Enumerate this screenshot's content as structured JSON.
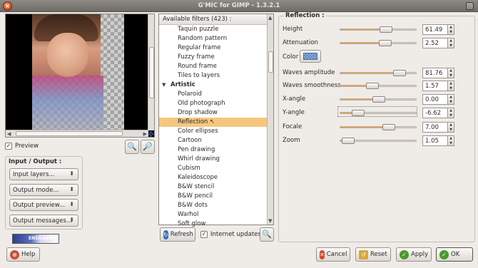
{
  "window": {
    "title": "G'MIC for GIMP - 1.3.2.1"
  },
  "preview": {
    "checkbox_label": "Preview",
    "checked": true
  },
  "io": {
    "title": "Input / Output :",
    "combos": [
      "Input layers...",
      "Output mode...",
      "Output preview...",
      "Output messages..."
    ]
  },
  "logo": {
    "text": "ENSICAEN"
  },
  "filters": {
    "header": "Available filters (423) :",
    "items": [
      {
        "label": "Taquin puzzle",
        "kind": "item"
      },
      {
        "label": "Random pattern",
        "kind": "item"
      },
      {
        "label": "Regular frame",
        "kind": "item"
      },
      {
        "label": "Fuzzy frame",
        "kind": "item"
      },
      {
        "label": "Round frame",
        "kind": "item"
      },
      {
        "label": "Tiles to layers",
        "kind": "item"
      },
      {
        "label": "Artistic",
        "kind": "category"
      },
      {
        "label": "Polaroid",
        "kind": "item"
      },
      {
        "label": "Old photograph",
        "kind": "item"
      },
      {
        "label": "Drop shadow",
        "kind": "item"
      },
      {
        "label": "Reflection",
        "kind": "selected"
      },
      {
        "label": "Color ellipses",
        "kind": "item"
      },
      {
        "label": "Cartoon",
        "kind": "item"
      },
      {
        "label": "Pen drawing",
        "kind": "item"
      },
      {
        "label": "Whirl drawing",
        "kind": "item"
      },
      {
        "label": "Cubism",
        "kind": "item"
      },
      {
        "label": "Kaleidoscope",
        "kind": "item"
      },
      {
        "label": "B&W stencil",
        "kind": "item"
      },
      {
        "label": "B&W pencil",
        "kind": "item"
      },
      {
        "label": "B&W dots",
        "kind": "item"
      },
      {
        "label": "Warhol",
        "kind": "item"
      },
      {
        "label": "Soft glow",
        "kind": "item"
      }
    ],
    "refresh_label": "Refresh",
    "internet_updates_label": "Internet updates",
    "internet_updates_checked": true
  },
  "params": {
    "title": "Reflection :",
    "color_label": "Color",
    "rows": [
      {
        "label": "Height",
        "value": "61.49",
        "fraction": 0.615
      },
      {
        "label": "Attenuation",
        "value": "2.52",
        "fraction": 0.6
      },
      {
        "label": "Waves amplitude",
        "value": "81.76",
        "fraction": 0.82
      },
      {
        "label": "Waves smoothness",
        "value": "1.57",
        "fraction": 0.4
      },
      {
        "label": "X-angle",
        "value": "0.00",
        "fraction": 0.5
      },
      {
        "label": "Y-angle",
        "value": "-6.62",
        "fraction": 0.18
      },
      {
        "label": "Focale",
        "value": "7.00",
        "fraction": 0.66
      },
      {
        "label": "Zoom",
        "value": "1.05",
        "fraction": 0.02
      }
    ]
  },
  "buttons": {
    "help": "Help",
    "cancel": "Cancel",
    "reset": "Reset",
    "apply": "Apply",
    "ok": "OK"
  },
  "colors": {
    "selection": "#f5c77e",
    "slider_fill": "#f09b3d",
    "cancel_icon": "#d8452c",
    "apply_icon": "#4a9a2c"
  }
}
